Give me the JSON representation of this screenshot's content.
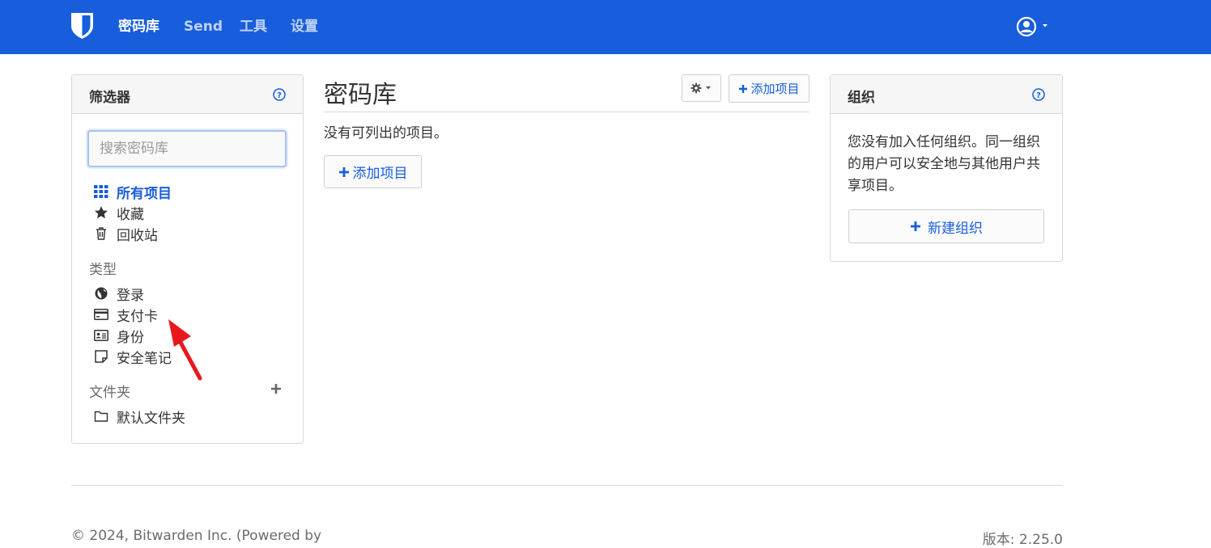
{
  "nav": {
    "items": [
      "密码库",
      "Send",
      "工具",
      "设置"
    ]
  },
  "filter": {
    "title": "筛选器",
    "search_placeholder": "搜索密码库",
    "items": [
      {
        "label": "所有项目",
        "icon": "grid-icon"
      },
      {
        "label": "收藏",
        "icon": "star-icon"
      },
      {
        "label": "回收站",
        "icon": "trash-icon"
      }
    ],
    "types_label": "类型",
    "types": [
      {
        "label": "登录",
        "icon": "globe-icon"
      },
      {
        "label": "支付卡",
        "icon": "credit-card-icon"
      },
      {
        "label": "身份",
        "icon": "id-card-icon"
      },
      {
        "label": "安全笔记",
        "icon": "note-icon"
      }
    ],
    "folders_label": "文件夹",
    "folders": [
      {
        "label": "默认文件夹",
        "icon": "folder-icon"
      }
    ]
  },
  "main": {
    "title": "密码库",
    "add_item_small": "添加项目",
    "empty_text": "没有可列出的项目。",
    "add_item": "添加项目"
  },
  "org": {
    "title": "组织",
    "text": "您没有加入任何组织。同一组织的用户可以安全地与其他用户共享项目。",
    "new_org_button": "新建组织"
  },
  "footer": {
    "copyright": "© 2024, Bitwarden Inc. (Powered by",
    "version": "版本: 2.25.0"
  },
  "colors": {
    "brand": "#175ddc",
    "annotation": "#e8191c"
  }
}
